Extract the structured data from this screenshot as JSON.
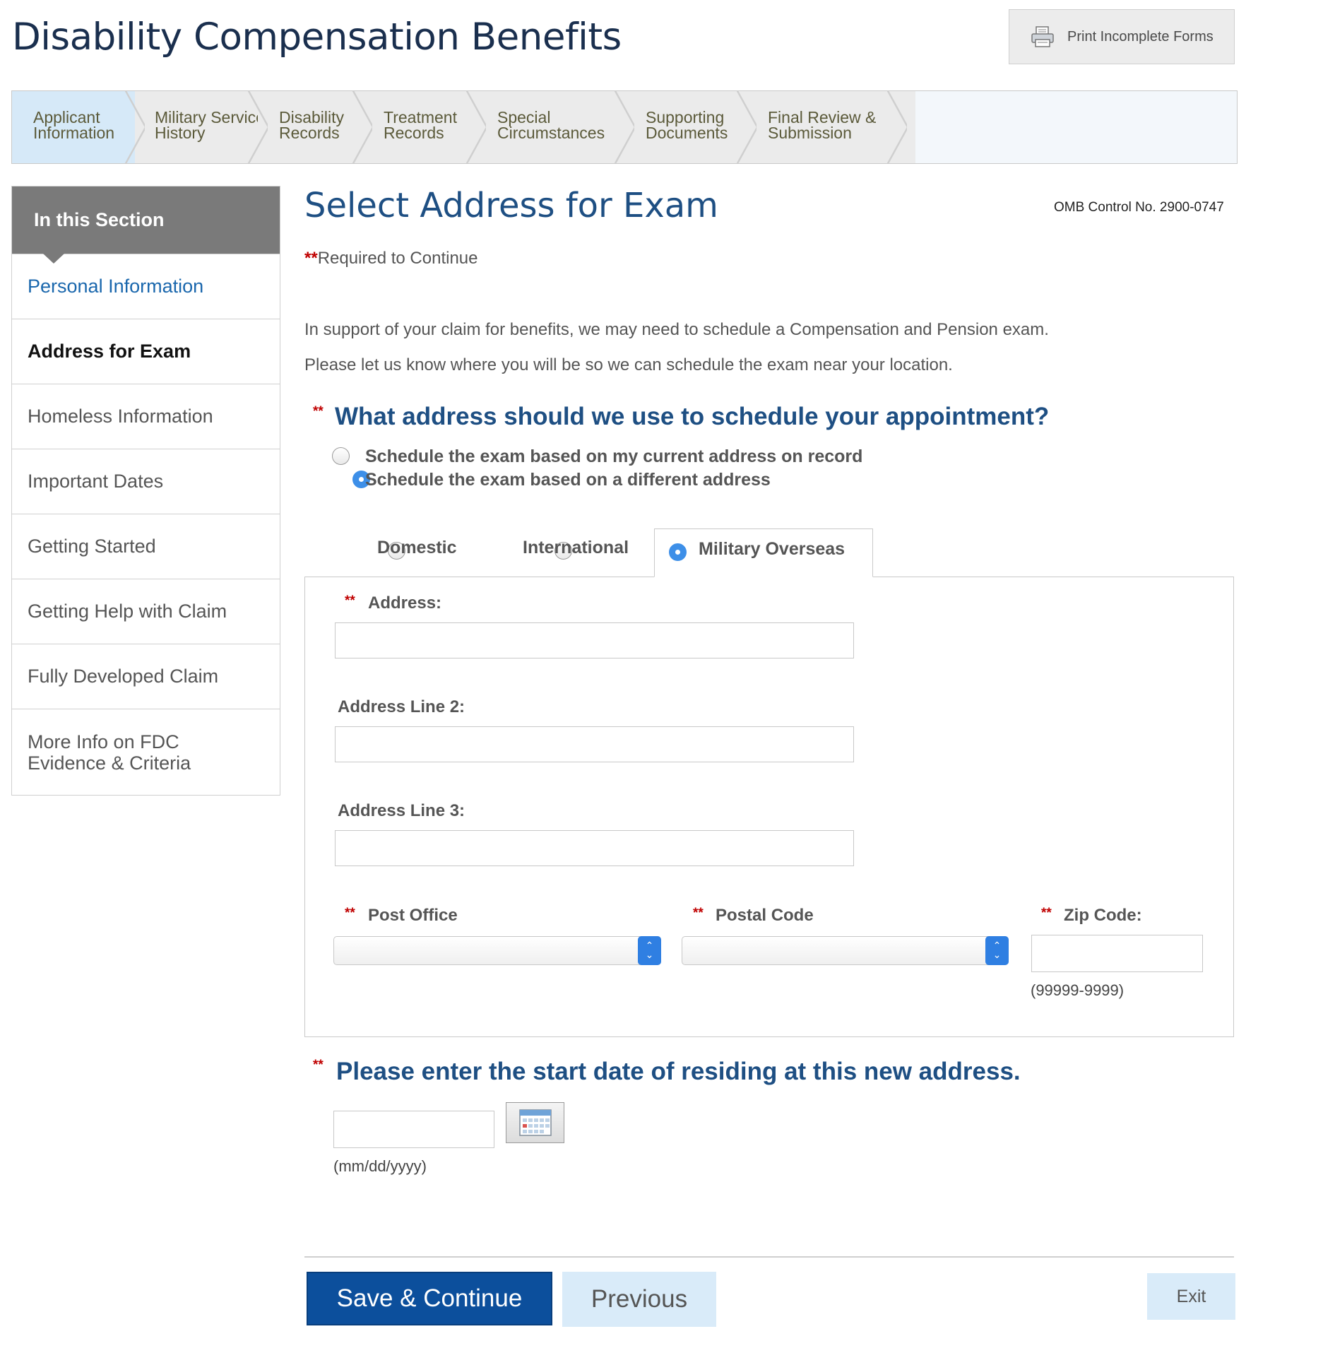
{
  "header": {
    "title": "Disability Compensation Benefits",
    "print_label": "Print Incomplete Forms",
    "print_icon": "printer-icon"
  },
  "steps": [
    {
      "line1": "Applicant",
      "line2": "Information",
      "active": true
    },
    {
      "line1": "Military Service",
      "line2": "History"
    },
    {
      "line1": "Disability",
      "line2": "Records"
    },
    {
      "line1": "Treatment",
      "line2": "Records"
    },
    {
      "line1": "Special",
      "line2": "Circumstances"
    },
    {
      "line1": "Supporting",
      "line2": "Documents"
    },
    {
      "line1": "Final Review &",
      "line2": "Submission"
    }
  ],
  "sidebar": {
    "heading": "In this Section",
    "items": [
      {
        "label": "Personal Information"
      },
      {
        "label": "Address for Exam",
        "current": true
      },
      {
        "label": "Homeless Information"
      },
      {
        "label": "Important Dates"
      },
      {
        "label": "Getting Started"
      },
      {
        "label": "Getting Help with Claim"
      },
      {
        "label": "Fully Developed Claim"
      },
      {
        "label_line1": "More Info on FDC",
        "label_line2": "Evidence & Criteria"
      }
    ]
  },
  "main": {
    "title": "Select Address for Exam",
    "omb": "OMB Control No. 2900-0747",
    "required_marker": "**",
    "required_text": "Required to Continue",
    "intro1": "In support of your claim for benefits, we may need to schedule a Compensation and Pension exam.",
    "intro2": "Please let us know where you will be so we can schedule the exam near your location.",
    "question1": "What address should we use to schedule your appointment?",
    "options": [
      {
        "label": "Schedule the exam based on my current address on record",
        "selected": false
      },
      {
        "label": "Schedule the exam based on a different address",
        "selected": true
      }
    ],
    "address_types": [
      {
        "label": "Domestic",
        "selected": false
      },
      {
        "label": "International",
        "selected": false
      },
      {
        "label": "Military Overseas",
        "selected": true
      }
    ],
    "form": {
      "address_label": "Address:",
      "address_value": "",
      "address2_label": "Address Line 2:",
      "address2_value": "",
      "address3_label": "Address Line 3:",
      "address3_value": "",
      "post_office_label": "Post Office",
      "post_office_value": "",
      "postal_code_label": "Postal Code",
      "postal_code_value": "",
      "zip_label": "Zip Code:",
      "zip_value": "",
      "zip_hint": "(99999-9999)"
    },
    "question2": "Please enter the start date of residing at this new address.",
    "date_value": "",
    "date_hint": "(mm/dd/yyyy)",
    "calendar_icon": "calendar-icon"
  },
  "footer": {
    "save_label": "Save & Continue",
    "previous_label": "Previous",
    "exit_label": "Exit"
  },
  "colors": {
    "title_blue": "#1e4f83",
    "required_red": "#c00000",
    "save_button": "#0c4f9c",
    "light_button": "#d9ebf9",
    "active_step": "#d6e9f8",
    "radio_selected": "#3d8fe8"
  }
}
